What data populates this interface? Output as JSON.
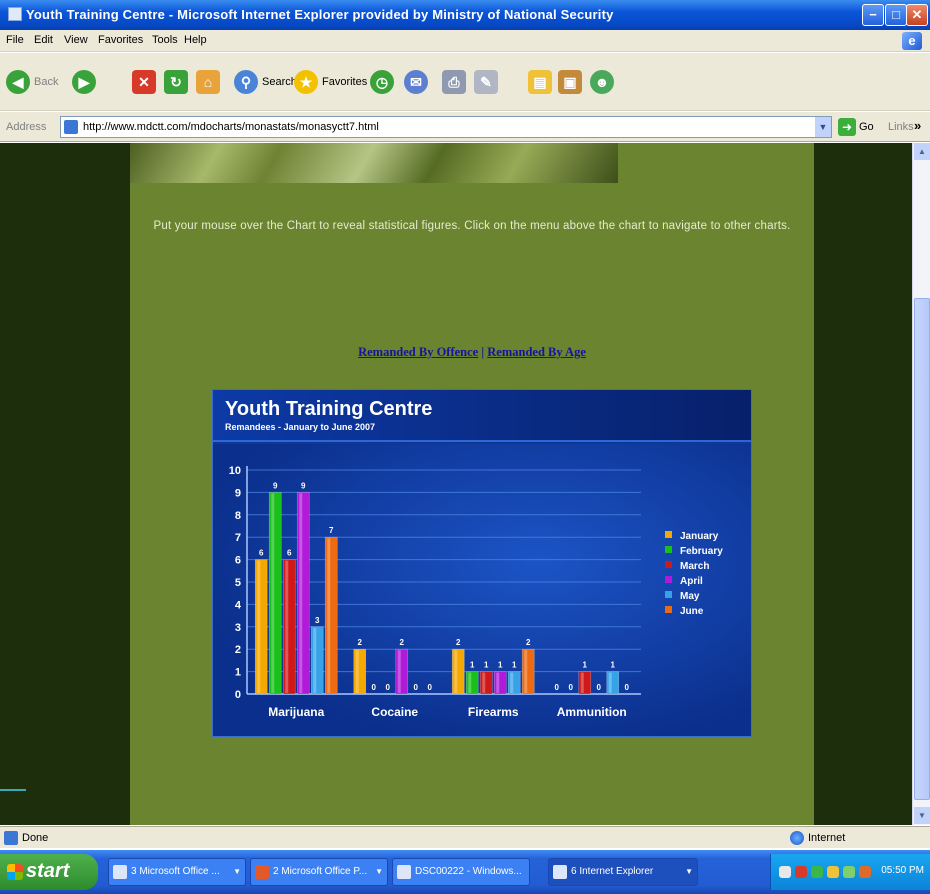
{
  "window": {
    "title": "Youth Training Centre - Microsoft Internet Explorer provided by Ministry of National Security",
    "min_label": "−",
    "max_label": "□",
    "close_label": "✕"
  },
  "menu": [
    "File",
    "Edit",
    "View",
    "Favorites",
    "Tools",
    "Help"
  ],
  "toolbar": {
    "back": "Back",
    "search": "Search",
    "favorites": "Favorites"
  },
  "address": {
    "label": "Address",
    "url": "http://www.mdctt.com/mdocharts/monastats/monasyctt7.html",
    "go": "Go",
    "links": "Links"
  },
  "page": {
    "intro": "Put your mouse over the Chart to reveal statistical figures. Click on the menu above the chart to navigate to other charts.",
    "link_offence": "Remanded By Offence",
    "link_age": "Remanded By Age",
    "link_sep": "|"
  },
  "chart_data": {
    "type": "bar",
    "title": "Youth Training Centre",
    "subtitle": "Remandees - January to June 2007",
    "categories": [
      "Marijuana",
      "Cocaine",
      "Firearms",
      "Ammunition"
    ],
    "series": [
      {
        "name": "January",
        "color": "#f5a800",
        "values": [
          6,
          2,
          2,
          0
        ]
      },
      {
        "name": "February",
        "color": "#19c019",
        "values": [
          9,
          0,
          1,
          0
        ]
      },
      {
        "name": "March",
        "color": "#d01818",
        "values": [
          6,
          0,
          1,
          1
        ]
      },
      {
        "name": "April",
        "color": "#b01ad8",
        "values": [
          9,
          2,
          1,
          0
        ]
      },
      {
        "name": "May",
        "color": "#36a2e8",
        "values": [
          3,
          0,
          1,
          1
        ]
      },
      {
        "name": "June",
        "color": "#ee6a10",
        "values": [
          7,
          0,
          2,
          0
        ]
      }
    ],
    "ylim": [
      0,
      10
    ],
    "yticks": [
      "0",
      "1",
      "2",
      "3",
      "4",
      "5",
      "6",
      "7",
      "8",
      "9",
      "10"
    ],
    "grid": true,
    "legend": "right"
  },
  "status": {
    "text": "Done",
    "zone": "Internet"
  },
  "taskbar": {
    "start": "start",
    "tasks": [
      "3 Microsoft Office ...",
      "2 Microsoft Office P...",
      "DSC00222 - Windows...",
      "6 Internet Explorer"
    ],
    "clock": "05:50 PM"
  }
}
